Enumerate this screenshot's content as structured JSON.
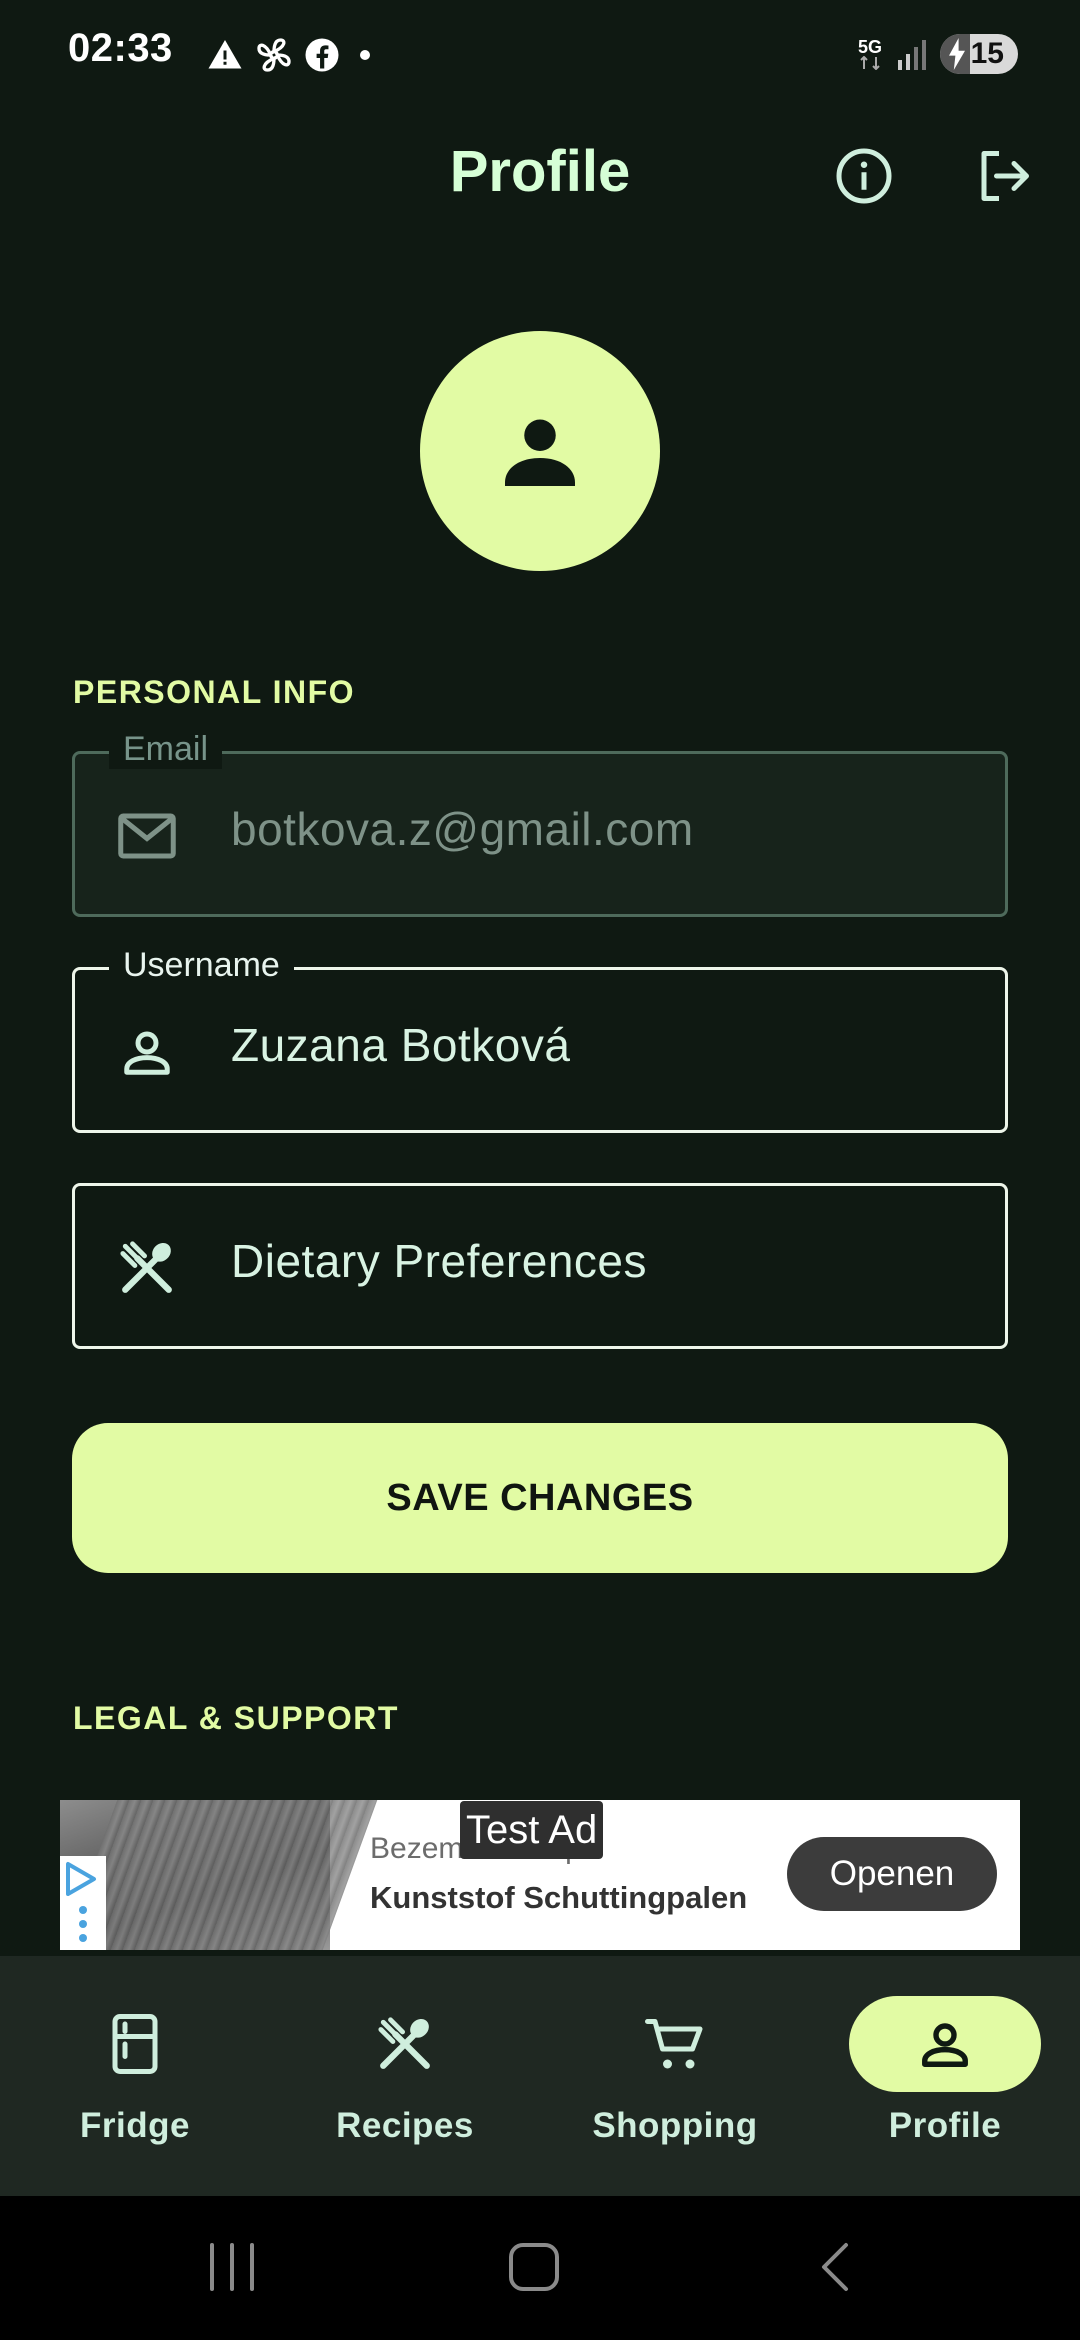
{
  "status_bar": {
    "time": "02:33",
    "network": "5G",
    "battery": "15"
  },
  "header": {
    "title": "Profile",
    "icons": [
      "info-icon",
      "logout-icon"
    ]
  },
  "avatar": {
    "icon": "person-icon"
  },
  "personal_info": {
    "section_title": "PERSONAL INFO",
    "email": {
      "label": "Email",
      "value": "botkova.z@gmail.com",
      "icon": "mail-icon",
      "disabled": true
    },
    "username": {
      "label": "Username",
      "value": "Zuzana Botková",
      "icon": "person-outline-icon"
    },
    "dietary": {
      "placeholder": "Dietary Preferences",
      "icon": "utensils-icon"
    },
    "save_label": "SAVE CHANGES"
  },
  "legal_support": {
    "section_title": "LEGAL & SUPPORT"
  },
  "ad": {
    "badge": "Test Ad",
    "advertiser": "Bezemer Group",
    "headline": "Kunststof Schuttingpalen",
    "cta": "Openen"
  },
  "bottom_nav": {
    "items": [
      {
        "label": "Fridge",
        "icon": "fridge-icon",
        "active": false
      },
      {
        "label": "Recipes",
        "icon": "utensils-icon",
        "active": false
      },
      {
        "label": "Shopping",
        "icon": "cart-icon",
        "active": false
      },
      {
        "label": "Profile",
        "icon": "person-outline-icon",
        "active": true
      }
    ]
  },
  "colors": {
    "background": "#0f1912",
    "accent": "#e2fba4",
    "text": "#cfeedd",
    "nav_background": "#1f2822"
  }
}
